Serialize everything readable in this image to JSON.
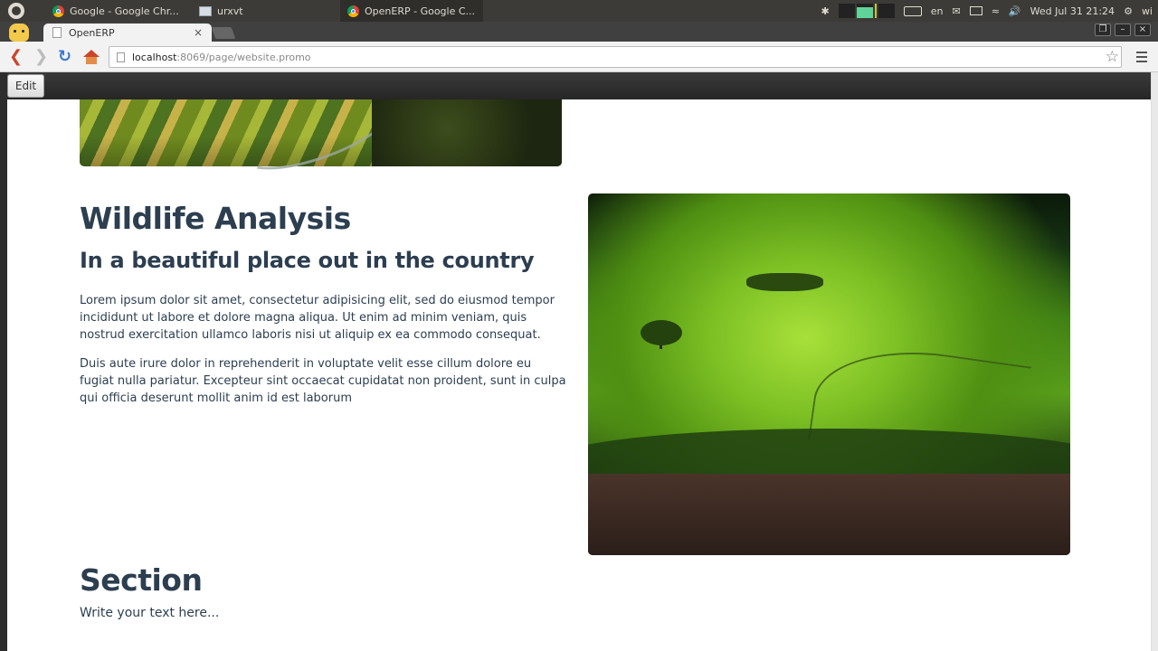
{
  "os": {
    "window_tabs": [
      {
        "label": "Google - Google Chr...",
        "icon": "chrome-icon"
      },
      {
        "label": "urxvt",
        "icon": "terminal-icon"
      },
      {
        "label": "OpenERP - Google C...",
        "icon": "chrome-icon"
      }
    ],
    "tray": {
      "lang": "en",
      "datetime": "Wed Jul 31  21:24",
      "user": "wi"
    }
  },
  "browser": {
    "tab_title": "OpenERP",
    "tab_close": "×",
    "url_host": "localhost",
    "url_path": ":8069/page/website.promo"
  },
  "editbar": {
    "edit_label": "Edit"
  },
  "content": {
    "headline": "Wildlife Analysis",
    "subheadline": "In a beautiful place out in the country",
    "paragraph1": "Lorem ipsum dolor sit amet, consectetur adipisicing elit, sed do eiusmod tempor incididunt ut labore et dolore magna aliqua. Ut enim ad minim veniam, quis nostrud exercitation ullamco laboris nisi ut aliquip ex ea commodo consequat.",
    "paragraph2": "Duis aute irure dolor in reprehenderit in voluptate velit esse cillum dolore eu fugiat nulla pariatur. Excepteur sint occaecat cupidatat non proident, sunt in culpa qui officia deserunt mollit anim id est laborum",
    "section_title": "Section",
    "section_text": "Write your text here..."
  },
  "colors": {
    "heading": "#2c3e50",
    "os_panel": "#3c3b37",
    "back_arrow": "#c9462b",
    "reload": "#3b78c8"
  }
}
